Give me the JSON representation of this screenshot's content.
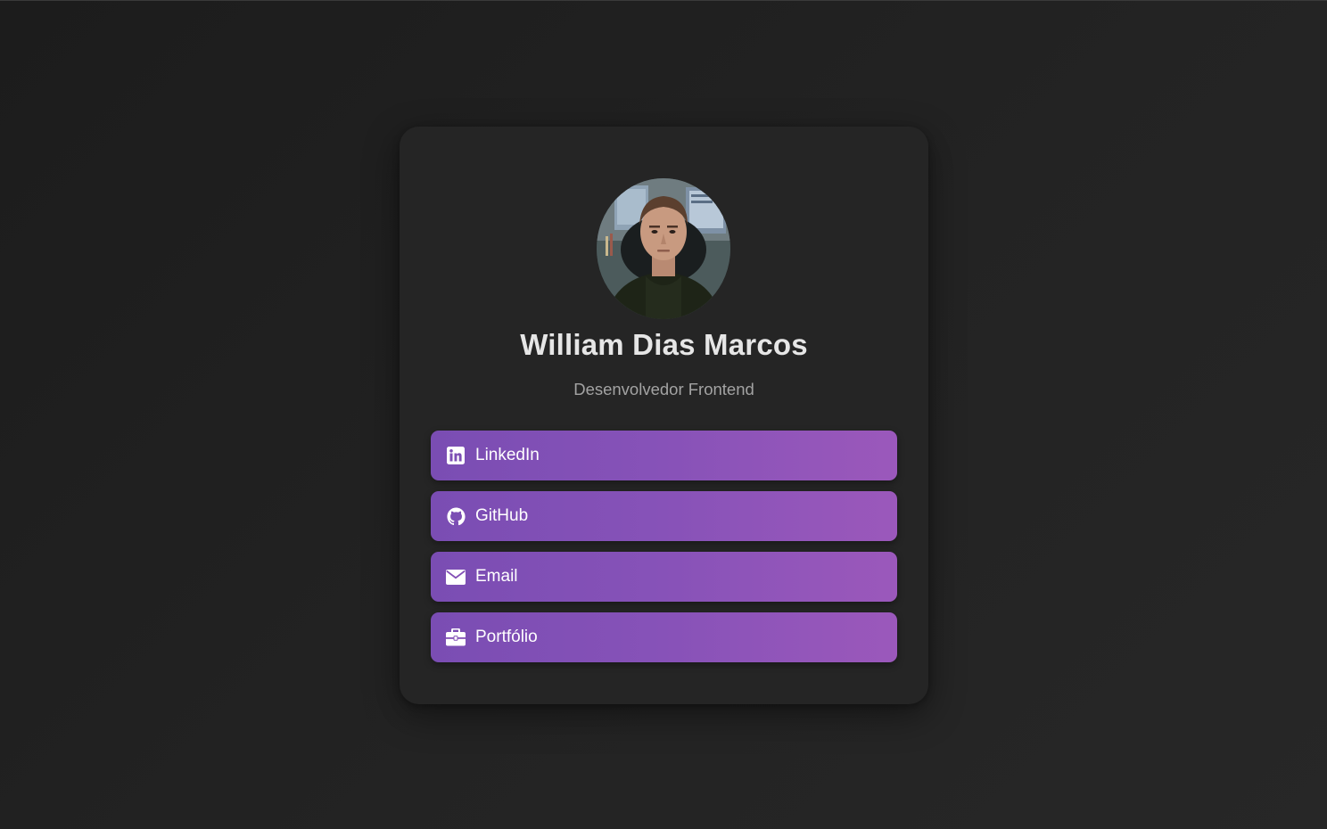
{
  "profile": {
    "name": "William Dias Marcos",
    "title": "Desenvolvedor Frontend"
  },
  "links": [
    {
      "label": "LinkedIn",
      "icon": "linkedin-icon"
    },
    {
      "label": "GitHub",
      "icon": "github-icon"
    },
    {
      "label": "Email",
      "icon": "envelope-icon"
    },
    {
      "label": "Portfólio",
      "icon": "briefcase-icon"
    }
  ],
  "colors": {
    "background": "#222222",
    "card": "#252525",
    "button_gradient_start": "#7a4db3",
    "button_gradient_end": "#9b58bb",
    "name_text": "#e6e6e6",
    "subtitle_text": "#a3a3a3"
  }
}
